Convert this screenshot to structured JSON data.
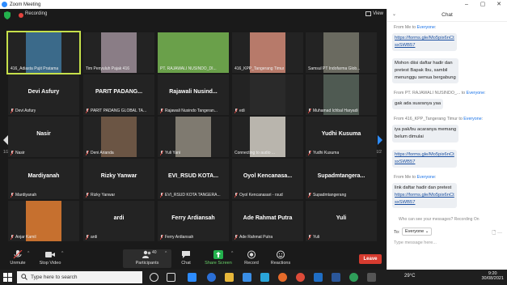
{
  "window": {
    "title": "Zoom Meeting",
    "controls": [
      "–",
      "▢",
      "✕"
    ]
  },
  "meeting": {
    "recording_label": "Recording",
    "view_label": "View",
    "page_left": "1/2",
    "page_right": "1/2",
    "tiles": [
      {
        "big": "",
        "name": "416_Adiasta Pujit Pratama",
        "video": "person1",
        "active": true
      },
      {
        "big": "",
        "name": "Tim Penyuluh Pajak 416",
        "video": "person2"
      },
      {
        "big": "",
        "name": "PT. RAJAWALI NUSINDO_DI...",
        "video": "green"
      },
      {
        "big": "",
        "name": "416_KPP_Tangerang Timur",
        "video": "person3"
      },
      {
        "big": "",
        "name": "Samsul PT Indofarma Glob...",
        "video": "building"
      },
      {
        "big": "Devi Asfury",
        "name": "Devi Asfury",
        "video": "",
        "mic": true
      },
      {
        "big": "PARIT PADANG...",
        "name": "PARIT PADANG GLOBAL TA...",
        "video": "",
        "mic": true
      },
      {
        "big": "Rajawali Nusind...",
        "name": "Rajawali Nusindo Tangeran...",
        "video": "",
        "mic": true
      },
      {
        "big": "",
        "name": "edi",
        "video": "dark",
        "mic": true
      },
      {
        "big": "",
        "name": "Muhamad Ichbal Haryadi",
        "video": "person4",
        "mic": true
      },
      {
        "big": "Nasir",
        "name": "Nasir",
        "video": "",
        "mic": true
      },
      {
        "big": "",
        "name": "Deni Arianda",
        "video": "img2",
        "mic": true
      },
      {
        "big": "",
        "name": "Yuli Yani",
        "video": "person5",
        "mic": true
      },
      {
        "big": "",
        "name": "Connecting to audio ...",
        "video": "light",
        "mic": false
      },
      {
        "big": "Yudhi Kusuma",
        "name": "Yudhi Kusuma",
        "video": "",
        "mic": true
      },
      {
        "big": "Mardiyanah",
        "name": "Mardiyanah",
        "video": "",
        "mic": true
      },
      {
        "big": "Rizky Yanwar",
        "name": "Rizky Yanwar",
        "video": "",
        "mic": true
      },
      {
        "big": "EVI_RSUD KOTA...",
        "name": "EVI_RSUD KOTA TANGERA...",
        "video": "",
        "mic": true
      },
      {
        "big": "Oyol Kencanasa...",
        "name": "Oyol Kencanasari - rsud",
        "video": "",
        "mic": true
      },
      {
        "big": "Supadmtangera...",
        "name": "Supadmtangerang",
        "video": "",
        "mic": true
      },
      {
        "big": "",
        "name": "Anjar Kamil",
        "video": "desert",
        "mic": true
      },
      {
        "big": "ardi",
        "name": "ardi",
        "video": "",
        "mic": true
      },
      {
        "big": "Ferry Ardiansah",
        "name": "Ferry Ardiansah",
        "video": "",
        "mic": true
      },
      {
        "big": "Ade Rahmat Putra",
        "name": "Ade Rahmat Putra",
        "video": "",
        "mic": true
      },
      {
        "big": "Yuli",
        "name": "Yuli",
        "video": "",
        "mic": true
      }
    ]
  },
  "toolbar": {
    "unmute": "Unmute",
    "stop_video": "Stop Video",
    "participants": "Participants",
    "participants_count": "40",
    "chat": "Chat",
    "share_screen": "Share Screen",
    "record": "Record",
    "reactions": "Reactions",
    "leave": "Leave"
  },
  "chat": {
    "title": "Chat",
    "messages": [
      {
        "from": "From Me to ",
        "to": "Everyone",
        "text": [
          "https://forms.gle/Mo5pix6nCt",
          "sxSWB57"
        ],
        "link": true
      },
      {
        "from": "",
        "to": "",
        "text": [
          "Mohon diisi daftar hadir dan",
          "pretest Bapak Ibu, sambil",
          "menunggu semua bergabung"
        ],
        "link": false
      },
      {
        "from": "From PT. RAJAWALI NUSINDO_...  to ",
        "to": "Everyone",
        "text": [
          "gak ada suaranya yaa"
        ],
        "link": false
      },
      {
        "from": "From 416_KPP_Tangerang Timur to ",
        "to": "Everyone",
        "text": [
          "iya pak/bu acaranya memang",
          "belum dimulai"
        ],
        "link": false
      },
      {
        "from": "",
        "to": "",
        "text": [
          "https://forms.gle/Mo5pix6nCt",
          "sxSWB57"
        ],
        "link": true
      },
      {
        "from": "From Me to ",
        "to": "Everyone",
        "text": [
          "link daftar hadir dan pretest",
          "https://forms.gle/Mo5pix6nCt",
          "sxSWB57"
        ],
        "link": false
      }
    ],
    "who_can_see": "Who can see your messages? Recording On",
    "to_label": "To:",
    "recipient": "Everyone",
    "placeholder": "Type message here..."
  },
  "taskbar": {
    "search_text": "Type here to search",
    "weather": "29°C",
    "time": "9:20",
    "date": "30/08/2021"
  }
}
